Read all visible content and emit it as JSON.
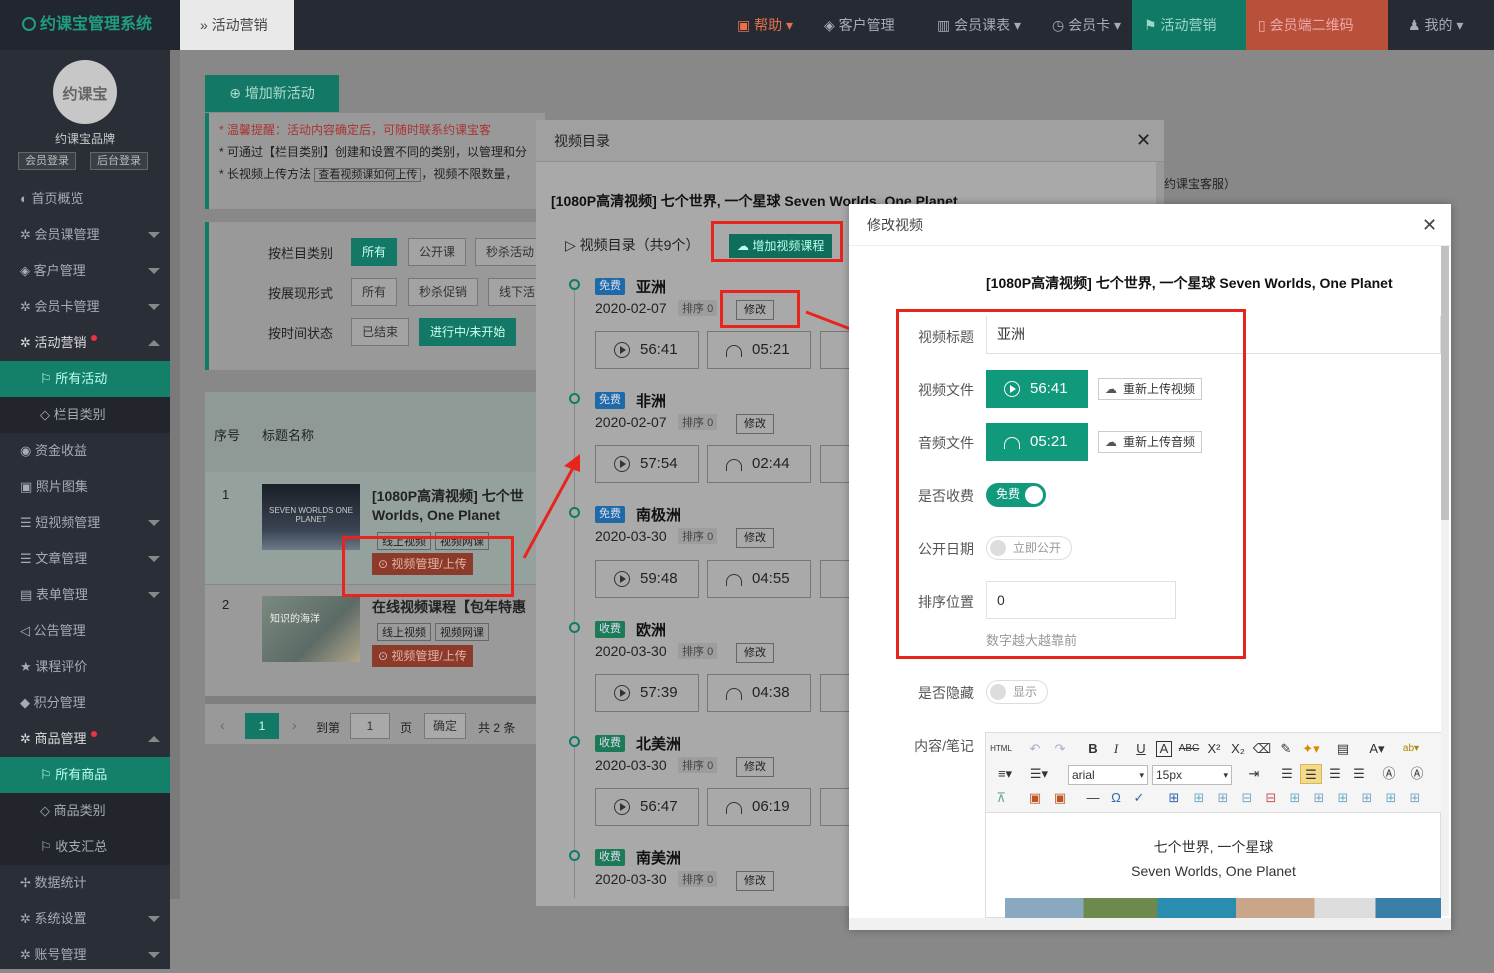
{
  "topbar": {
    "brand": "约课宝管理系统",
    "breadcrumb": "活动营销",
    "nav": [
      {
        "label": "帮助",
        "icon": "help-icon"
      },
      {
        "label": "客户管理",
        "icon": "users-icon"
      },
      {
        "label": "会员课表",
        "icon": "calendar-icon"
      },
      {
        "label": "会员卡",
        "icon": "card-icon"
      },
      {
        "label": "活动营销",
        "icon": "flag-icon"
      },
      {
        "label": "会员端二维码",
        "icon": "phone-icon"
      },
      {
        "label": "我的",
        "icon": "user-icon"
      }
    ]
  },
  "sidebar": {
    "logo_text": "约课宝",
    "brand_name": "约课宝品牌",
    "member_login": "会员登录",
    "admin_login": "后台登录",
    "items": [
      {
        "label": "首页概览"
      },
      {
        "label": "会员课管理"
      },
      {
        "label": "客户管理"
      },
      {
        "label": "会员卡管理"
      },
      {
        "label": "活动营销"
      },
      {
        "label": "所有活动"
      },
      {
        "label": "栏目类别"
      },
      {
        "label": "资金收益"
      },
      {
        "label": "照片图集"
      },
      {
        "label": "短视频管理"
      },
      {
        "label": "文章管理"
      },
      {
        "label": "表单管理"
      },
      {
        "label": "公告管理"
      },
      {
        "label": "课程评价"
      },
      {
        "label": "积分管理"
      },
      {
        "label": "商品管理"
      },
      {
        "label": "所有商品"
      },
      {
        "label": "商品类别"
      },
      {
        "label": "收支汇总"
      },
      {
        "label": "数据统计"
      },
      {
        "label": "系统设置"
      },
      {
        "label": "账号管理"
      }
    ]
  },
  "main": {
    "add_activity": "增加新活动",
    "notice": {
      "line1": "* 温馨提醒：活动内容确定后，可随时联系约课宝客",
      "line2": "* 可通过【栏目类别】创建和设置不同的类别，以管理和分",
      "line3a": "* 长视频上传方法",
      "line3b": "查看视频课如何上传",
      "line3c": "，视频不限数量，",
      "tail": "约课宝客服）"
    },
    "filters": {
      "by_category": "按栏目类别",
      "by_format": "按展现形式",
      "by_time": "按时间状态",
      "cat_options": [
        "所有",
        "公开课",
        "秒杀活动"
      ],
      "fmt_options": [
        "所有",
        "秒杀促销",
        "线下活"
      ],
      "time_options": [
        "已结束",
        "进行中/未开始"
      ]
    },
    "table": {
      "col_no": "序号",
      "col_title": "标题名称",
      "rows": [
        {
          "no": "1",
          "title_l1": "[1080P高清视频] 七个世",
          "title_l2": "Worlds, One Planet",
          "tag1": "线上视频",
          "tag2": "视频网课",
          "action": "视频管理/上传",
          "thumb_text": "SEVEN WORLDS ONE PLANET"
        },
        {
          "no": "2",
          "title_l1": "在线视频课程【包年特惠",
          "title_l2": "",
          "tag1": "线上视频",
          "tag2": "视频网课",
          "action": "视频管理/上传",
          "thumb_text": "知识的海洋"
        }
      ]
    },
    "pager": {
      "current": "1",
      "goto_label": "到第",
      "page_input": "1",
      "page_unit": "页",
      "confirm": "确定",
      "total": "共 2 条"
    }
  },
  "dialog_catalog": {
    "title": "视频目录",
    "video_title": "[1080P高清视频] 七个世界, 一个星球 Seven Worlds, One Planet",
    "catalog_label": "视频目录（共9个）",
    "add_course": "增加视频课程",
    "sort_label": "排序",
    "edit_label": "修改",
    "chapters": [
      {
        "badge": "免费",
        "name": "亚洲",
        "date": "2020-02-07",
        "sort": "0",
        "video": "56:41",
        "audio": "05:21",
        "paid": false
      },
      {
        "badge": "免费",
        "name": "非洲",
        "date": "2020-02-07",
        "sort": "0",
        "video": "57:54",
        "audio": "02:44",
        "paid": false
      },
      {
        "badge": "免费",
        "name": "南极洲",
        "date": "2020-03-30",
        "sort": "0",
        "video": "59:48",
        "audio": "04:55",
        "paid": false
      },
      {
        "badge": "收费",
        "name": "欧洲",
        "date": "2020-03-30",
        "sort": "0",
        "video": "57:39",
        "audio": "04:38",
        "paid": true
      },
      {
        "badge": "收费",
        "name": "北美洲",
        "date": "2020-03-30",
        "sort": "0",
        "video": "56:47",
        "audio": "06:19",
        "paid": true
      },
      {
        "badge": "收费",
        "name": "南美洲",
        "date": "2020-03-30",
        "sort": "0",
        "video": "",
        "audio": "",
        "paid": true
      }
    ]
  },
  "dialog_edit": {
    "title": "修改视频",
    "video_title": "[1080P高清视频] 七个世界, 一个星球 Seven Worlds, One Planet",
    "labels": {
      "title": "视频标题",
      "video_file": "视频文件",
      "audio_file": "音频文件",
      "charge": "是否收费",
      "publish": "公开日期",
      "sort": "排序位置",
      "hidden": "是否隐藏",
      "content": "内容/笔记"
    },
    "values": {
      "title": "亚洲",
      "video_duration": "56:41",
      "audio_duration": "05:21",
      "charge_toggle": "免费",
      "publish_toggle": "立即公开",
      "sort": "0",
      "sort_hint": "数字越大越靠前",
      "hidden_toggle": "显示"
    },
    "reupload_video": "重新上传视频",
    "reupload_audio": "重新上传音频",
    "editor": {
      "font": "arial",
      "size": "15px",
      "line1": "七个世界, 一个星球",
      "line2": "Seven Worlds, One Planet"
    }
  }
}
